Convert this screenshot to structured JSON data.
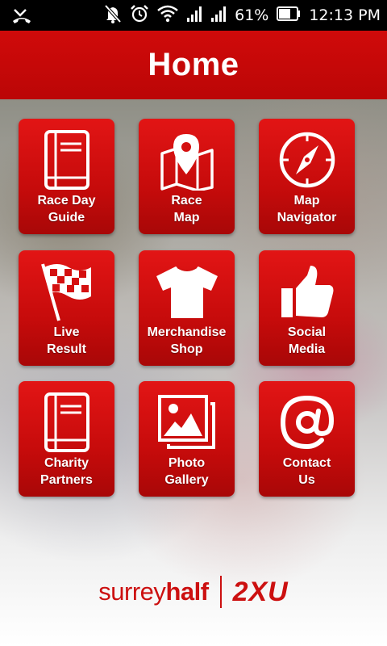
{
  "status_bar": {
    "battery": "61%",
    "time": "12:13 PM",
    "icons": [
      "missed-call-icon",
      "mute-icon",
      "alarm-icon",
      "wifi-icon",
      "signal-icon",
      "signal-icon",
      "battery-icon"
    ]
  },
  "header": {
    "title": "Home"
  },
  "tiles": [
    {
      "label": "Race Day\nGuide",
      "icon": "book-icon"
    },
    {
      "label": "Race\nMap",
      "icon": "map-pin-icon"
    },
    {
      "label": "Map\nNavigator",
      "icon": "compass-icon"
    },
    {
      "label": "Live\nResult",
      "icon": "checkered-flag-icon"
    },
    {
      "label": "Merchandise\nShop",
      "icon": "tshirt-icon"
    },
    {
      "label": "Social\nMedia",
      "icon": "thumbs-up-icon"
    },
    {
      "label": "Charity\nPartners",
      "icon": "book-icon"
    },
    {
      "label": "Photo\nGallery",
      "icon": "photo-gallery-icon"
    },
    {
      "label": "Contact\nUs",
      "icon": "at-sign-icon"
    }
  ],
  "footer": {
    "brand_left_light": "surrey",
    "brand_left_bold": "half",
    "brand_right": "2XU"
  },
  "colors": {
    "brand_red": "#cc0a0a",
    "tile_red": "#d41010"
  }
}
